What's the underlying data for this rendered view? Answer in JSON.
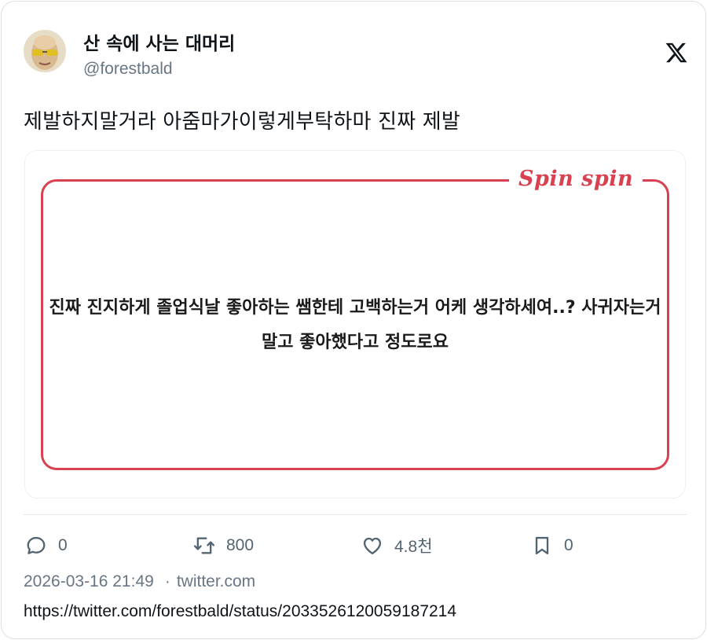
{
  "author": {
    "display_name": "산 속에 사는 대머리",
    "handle": "@forestbald",
    "avatar_icon": "bald-face-avatar"
  },
  "platform_icon": "x-logo-icon",
  "tweet": {
    "text": "제발하지말거라 아줌마가이렇게부탁하마 진짜 제발"
  },
  "media": {
    "brand": "Spin spin",
    "question": "진짜 진지하게 졸업식날 좋아하는 쌤한테 고백하는거 어케 생각하세여..? 사귀자는거 말고 좋아했다고 정도로요",
    "border_color": "#d8414f"
  },
  "actions": {
    "reply": {
      "icon": "reply-icon",
      "count": "0"
    },
    "retweet": {
      "icon": "retweet-icon",
      "count": "800"
    },
    "like": {
      "icon": "heart-icon",
      "count": "4.8천"
    },
    "bookmark": {
      "icon": "bookmark-icon",
      "count": "0"
    }
  },
  "meta": {
    "timestamp": "2026-03-16 21:49",
    "separator": "·",
    "source": "twitter.com",
    "url": "https://twitter.com/forestbald/status/2033526120059187214"
  }
}
